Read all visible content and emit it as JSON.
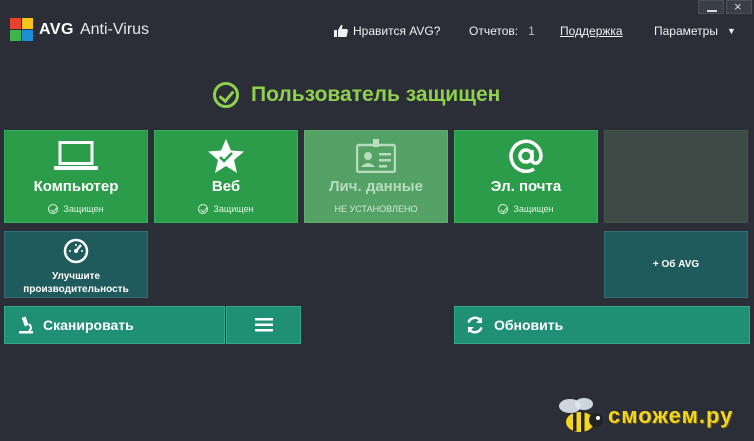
{
  "app": {
    "brand": "AVG",
    "product": "Anti-Virus"
  },
  "menu": {
    "like": "Нравится AVG?",
    "reports": "Отчетов:",
    "reports_count": "1",
    "support": "Поддержка",
    "settings": "Параметры",
    "settings_arrow": "▼"
  },
  "window": {
    "close": "×"
  },
  "status": {
    "text": "Пользователь защищен"
  },
  "tiles": [
    {
      "title": "Компьютер",
      "state": "Защищен"
    },
    {
      "title": "Веб",
      "state": "Защищен"
    },
    {
      "title": "Лич. данные",
      "state": "НЕ УСТАНОВЛЕНО"
    },
    {
      "title": "Эл. почта",
      "state": "Защищен"
    }
  ],
  "performance": {
    "line1": "Улучшите",
    "line2": "производительность"
  },
  "about": {
    "label": "+ Об AVG"
  },
  "actions": {
    "scan": "Сканировать",
    "update": "Обновить"
  },
  "watermark": {
    "text": "сможем.ру"
  },
  "colors": {
    "accent": "#8fd14f",
    "tile": "#2a9c4a",
    "button": "#1f8f75",
    "background": "#2b2e36"
  }
}
